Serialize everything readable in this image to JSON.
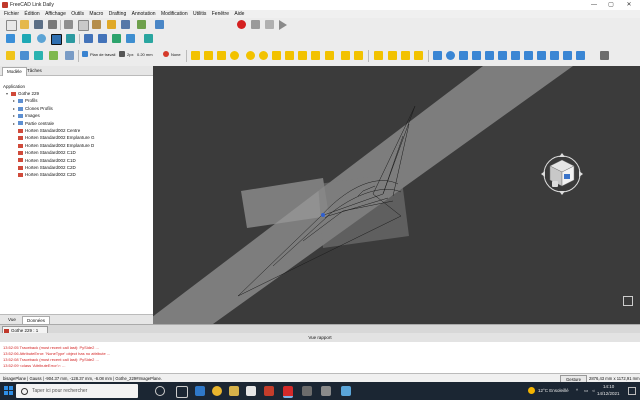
{
  "window": {
    "title": "FreeCAD Link Daily",
    "minimize": "—",
    "maximize": "▢",
    "close": "✕"
  },
  "menu": [
    "Fichier",
    "Édition",
    "Affichage",
    "Outils",
    "Macro",
    "Drafting",
    "Annotation",
    "Modification",
    "Utilitis",
    "Fenêtre",
    "Aide"
  ],
  "toolbar": {
    "workbench": "Draft",
    "working_plane": "Plan de travail",
    "snap_offset": "2px",
    "offset_value": "0.20 mm",
    "none_label": "None"
  },
  "panel": {
    "tabs": [
      "Modèle",
      "Tâches"
    ],
    "active_tab": "Modèle",
    "section_label": "Application",
    "tree": [
      {
        "label": "Gothe 229",
        "level": 0,
        "expander": "▾",
        "icon": "document-icon",
        "color": "#d04a3a"
      },
      {
        "label": "Profils",
        "level": 1,
        "expander": "▸",
        "icon": "folder-icon",
        "color": "#5d8fd1"
      },
      {
        "label": "Clones Profils",
        "level": 1,
        "expander": "▸",
        "icon": "folder-icon",
        "color": "#5d8fd1"
      },
      {
        "label": "Images",
        "level": 1,
        "expander": "▸",
        "icon": "folder-icon",
        "color": "#5d8fd1"
      },
      {
        "label": "Partie centrale",
        "level": 1,
        "expander": "▸",
        "icon": "folder-icon",
        "color": "#5d8fd1"
      },
      {
        "label": "Horten Standard002 Centre",
        "level": 1,
        "expander": "",
        "icon": "shape-icon",
        "color": "#d04a3a"
      },
      {
        "label": "Horten Standard002 Emplanture G",
        "level": 1,
        "expander": "",
        "icon": "shape-icon",
        "color": "#d04a3a"
      },
      {
        "label": "Horten Standard002 Emplanture D",
        "level": 1,
        "expander": "",
        "icon": "shape-icon",
        "color": "#d04a3a"
      },
      {
        "label": "Horten Standard002 C1D",
        "level": 1,
        "expander": "",
        "icon": "shape-icon",
        "color": "#d04a3a"
      },
      {
        "label": "Horten Standard002 C1D",
        "level": 1,
        "expander": "",
        "icon": "shape-icon",
        "color": "#d04a3a"
      },
      {
        "label": "Horten Standard002 C2D",
        "level": 1,
        "expander": "",
        "icon": "shape-icon",
        "color": "#d04a3a"
      },
      {
        "label": "Horten Standard002 C2D",
        "level": 1,
        "expander": "",
        "icon": "shape-icon",
        "color": "#d04a3a"
      }
    ],
    "bottom_tabs": [
      "Vue",
      "Données"
    ]
  },
  "document_tab": "Gothe 229 : 1",
  "report": {
    "title": "Vue rapport",
    "lines": [
      "13:52:05  Traceback (most recent call last): PySide2 ...",
      "13:52:06  AttributeError: 'NoneType' object has no attribute ...",
      "13:52:08  Traceback (most recent call last): PySide2 ...",
      "13:52:09  <class 'AttributeError'>: ..."
    ]
  },
  "status": {
    "preselected": "bisagePlane | Gauss | -904.37 mm, -128.37 mm, -6.08 mm | Gothe_229#ImagePlane.",
    "nav_style": "Gesture",
    "dimensions": "2876,43 mm x 1172,91 mm"
  },
  "taskbar": {
    "search_placeholder": "Taper ici pour rechercher",
    "weather": "12°C  Ensoleillé",
    "time": "14:10",
    "date": "14/12/2021"
  },
  "colors": {
    "accent_red": "#d21e1e",
    "taskbar": "#1b2633",
    "viewport": "#3b3b3b"
  }
}
